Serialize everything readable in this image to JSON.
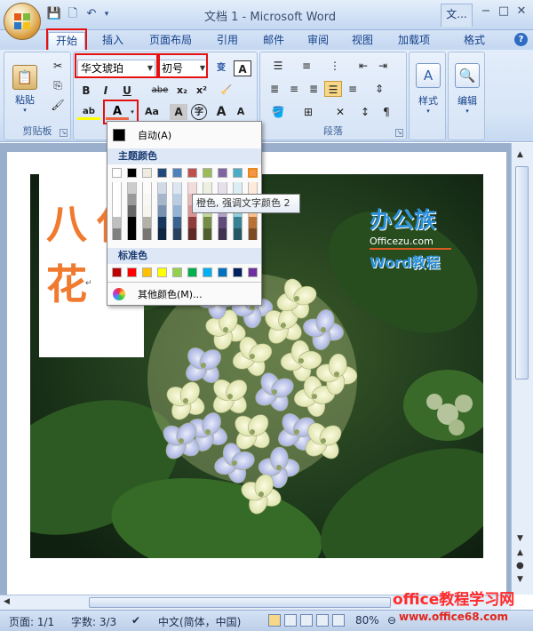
{
  "window": {
    "title": "文档 1 - Microsoft Word",
    "task_tab": "文...",
    "minimize": "−",
    "maximize": "□",
    "close": "✕"
  },
  "tabs": [
    {
      "label": "开始",
      "active": true
    },
    {
      "label": "插入"
    },
    {
      "label": "页面布局"
    },
    {
      "label": "引用"
    },
    {
      "label": "邮件"
    },
    {
      "label": "审阅"
    },
    {
      "label": "视图"
    },
    {
      "label": "加载项"
    },
    {
      "label": "格式"
    }
  ],
  "ribbon": {
    "clipboard": {
      "paste_label": "粘贴",
      "group_label": "剪贴板"
    },
    "font": {
      "font_name": "华文琥珀",
      "font_size": "初号",
      "bold": "B",
      "italic": "I",
      "underline": "U",
      "strike": "abe",
      "subscript": "x₂",
      "superscript": "x²",
      "font_color": "A",
      "change_case": "Aa",
      "char_shade": "A",
      "enclose": "字",
      "grow": "A",
      "shrink": "A",
      "phonetic": "变",
      "border": "A"
    },
    "paragraph": {
      "group_label": "段落"
    },
    "styles": {
      "label": "样式"
    },
    "editing": {
      "label": "编辑"
    }
  },
  "color_popup": {
    "auto_label": "自动(A)",
    "theme_header": "主题颜色",
    "standard_header": "标准色",
    "more_label": "其他颜色(M)...",
    "theme_top": [
      "#ffffff",
      "#000000",
      "#eeece1",
      "#1f497d",
      "#4f81bd",
      "#c0504d",
      "#9bbb59",
      "#8064a2",
      "#4bacc6",
      "#f79646"
    ],
    "standard": [
      "#c00000",
      "#ff0000",
      "#ffc000",
      "#ffff00",
      "#92d050",
      "#00b050",
      "#00b0f0",
      "#0070c0",
      "#002060",
      "#7030a0"
    ]
  },
  "tooltip": "橙色, 强调文字颜色 2",
  "document": {
    "char1": "八",
    "char2": "花",
    "brand_cn": "办公族",
    "brand_url": "Officezu.com",
    "brand_word": "Word教程"
  },
  "statusbar": {
    "page": "页面: 1/1",
    "words": "字数: 3/3",
    "lang": "中文(简体，中国)",
    "zoom": "80%"
  },
  "watermark": {
    "line1": "office教程学习网",
    "line2": "www.office68.com"
  }
}
